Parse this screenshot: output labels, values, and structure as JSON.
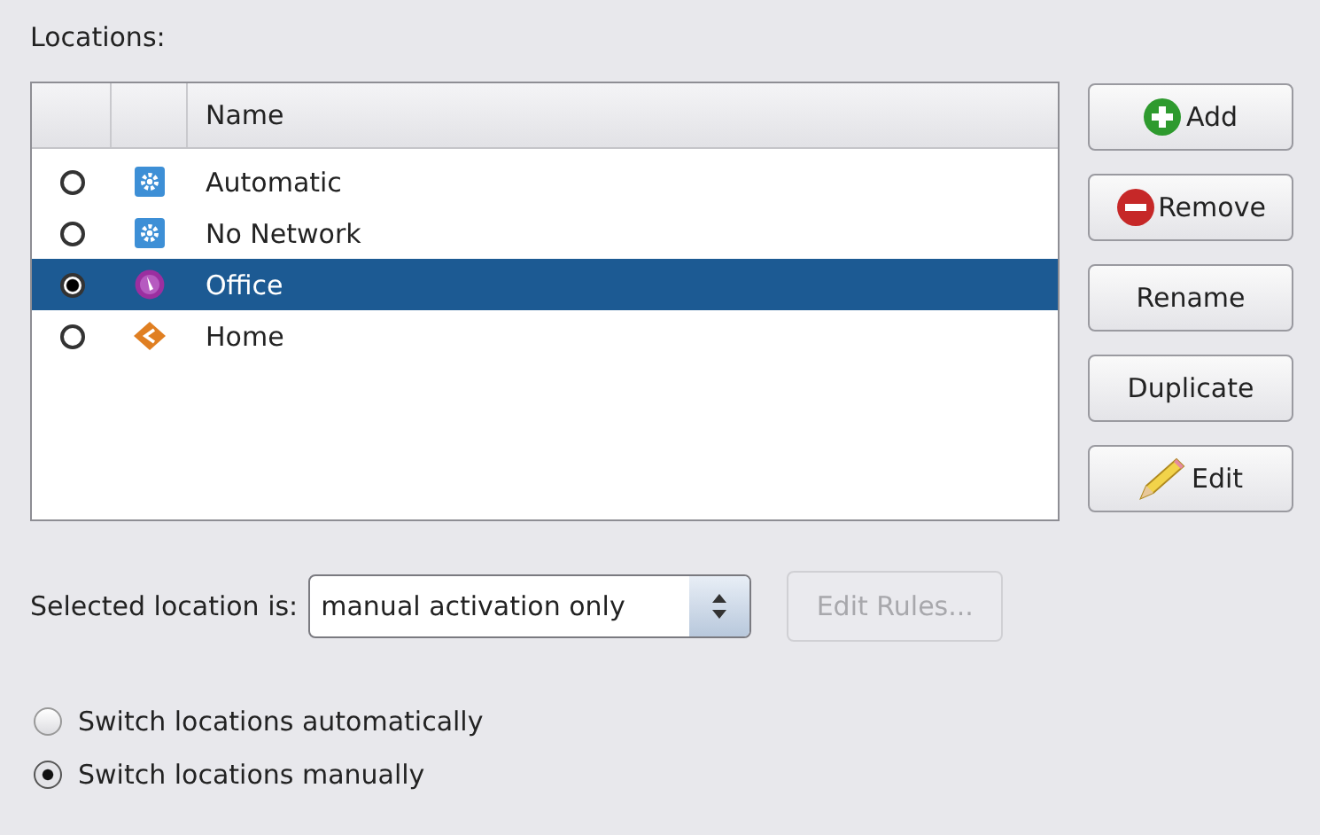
{
  "locations_label": "Locations:",
  "table": {
    "columns": [
      "Name"
    ],
    "rows": [
      {
        "name": "Automatic",
        "kind": "system",
        "active": false,
        "selected": false
      },
      {
        "name": "No Network",
        "kind": "system",
        "active": false,
        "selected": false
      },
      {
        "name": "Office",
        "kind": "office",
        "active": true,
        "selected": true
      },
      {
        "name": "Home",
        "kind": "home",
        "active": false,
        "selected": false
      }
    ]
  },
  "buttons": [
    {
      "label": "Add",
      "kind": "add"
    },
    {
      "label": "Remove",
      "kind": "remove"
    },
    {
      "label": "Rename",
      "kind": "plain"
    },
    {
      "label": "Duplicate",
      "kind": "plain"
    },
    {
      "label": "Edit",
      "kind": "edit"
    }
  ],
  "activation": {
    "label": "Selected location is:",
    "value": "manual activation only",
    "rules_button": {
      "label": "Edit Rules...",
      "disabled": true
    }
  },
  "switch_options": [
    {
      "label": "Switch locations automatically",
      "selected": false
    },
    {
      "label": "Switch locations manually",
      "selected": true
    }
  ]
}
